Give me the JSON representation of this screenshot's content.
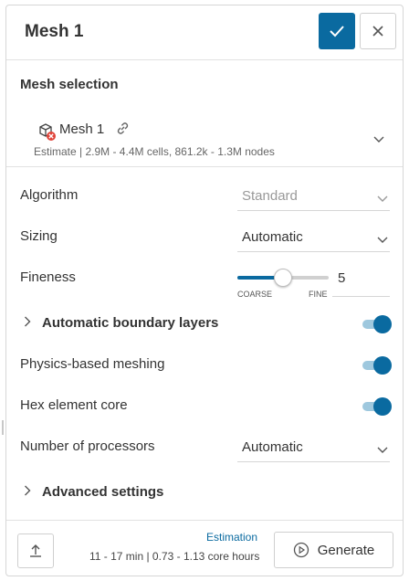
{
  "header": {
    "title": "Mesh 1",
    "confirm_icon": "check-icon",
    "close_icon": "close-icon"
  },
  "mesh_selection": {
    "title": "Mesh selection",
    "item": {
      "name": "Mesh 1",
      "icon": "mesh-error-icon",
      "link_icon": "link-icon",
      "estimate": "Estimate | 2.9M - 4.4M cells, 861.2k - 1.3M nodes"
    }
  },
  "settings": {
    "algorithm": {
      "label": "Algorithm",
      "value": "Standard"
    },
    "sizing": {
      "label": "Sizing",
      "value": "Automatic"
    },
    "fineness": {
      "label": "Fineness",
      "value": "5",
      "min_label": "COARSE",
      "max_label": "FINE",
      "level_fraction": 0.5
    },
    "boundary_layers": {
      "label": "Automatic boundary layers",
      "enabled": true
    },
    "physics_meshing": {
      "label": "Physics-based meshing",
      "enabled": true
    },
    "hex_core": {
      "label": "Hex element core",
      "enabled": true
    },
    "processors": {
      "label": "Number of processors",
      "value": "Automatic"
    },
    "advanced": {
      "label": "Advanced settings"
    }
  },
  "footer": {
    "upload_icon": "upload-icon",
    "estimation_title": "Estimation",
    "estimation_detail": "11 - 17 min | 0.73 - 1.13 core hours",
    "generate_label": "Generate",
    "generate_icon": "play-circle-icon"
  },
  "colors": {
    "accent": "#0a6aa0",
    "toggle_track": "#9ec8de",
    "error": "#e0443a"
  }
}
